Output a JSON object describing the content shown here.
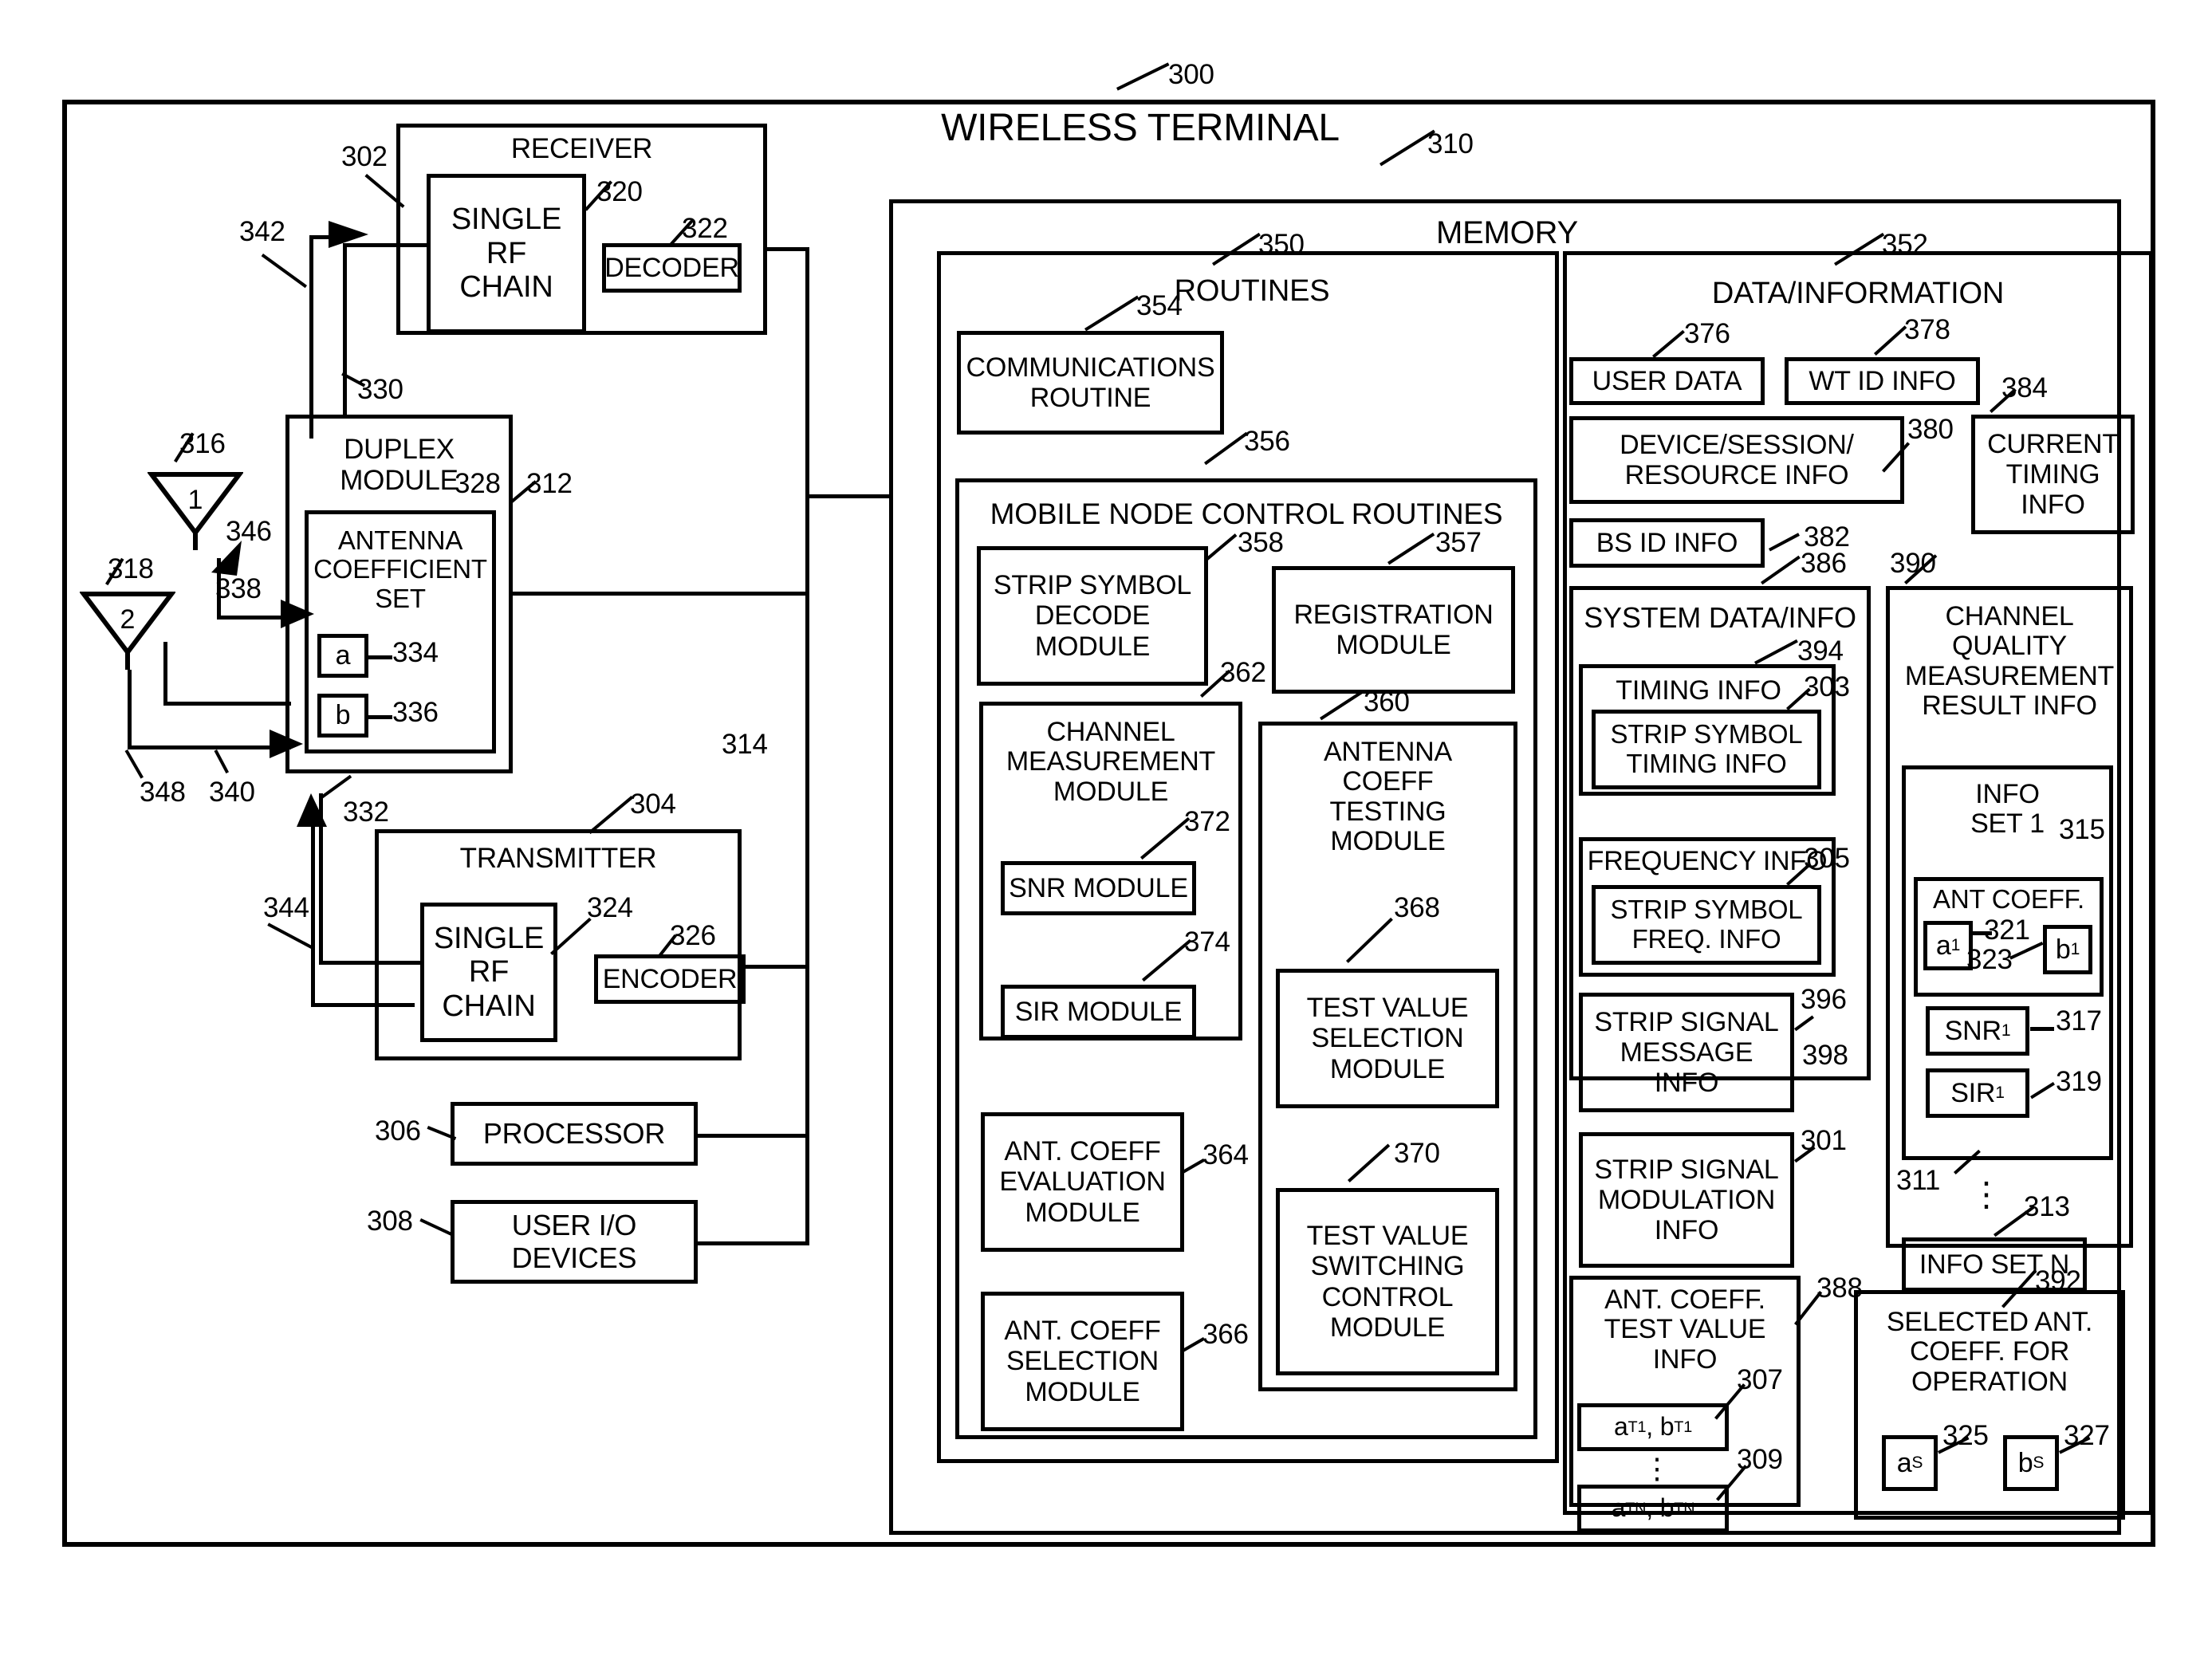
{
  "figure": {
    "title": "WIRELESS TERMINAL",
    "title_ref": "300"
  },
  "receiver": {
    "title": "RECEIVER",
    "ref": "302",
    "rf_chain": "SINGLE\nRF\nCHAIN",
    "rf_chain_ref": "320",
    "decoder": "DECODER",
    "decoder_ref": "322",
    "line_342": "342",
    "line_330": "330"
  },
  "duplex": {
    "title": "DUPLEX\nMODULE",
    "ref": "312",
    "coeff_title": "ANTENNA\nCOEFFICIENT\nSET",
    "coeff_ref": "328",
    "a_label": "a",
    "a_ref": "334",
    "b_label": "b",
    "b_ref": "336"
  },
  "antennas": {
    "first_label": "1",
    "first_ref": "316",
    "second_label": "2",
    "second_ref": "318",
    "line_346": "346",
    "line_338": "338",
    "line_348": "348",
    "line_340": "340",
    "line_332": "332",
    "line_344": "344",
    "bus_ref": "314"
  },
  "transmitter": {
    "title": "TRANSMITTER",
    "ref": "304",
    "rf_chain": "SINGLE\nRF\nCHAIN",
    "rf_chain_ref": "324",
    "encoder": "ENCODER",
    "encoder_ref": "326"
  },
  "processor": {
    "label": "PROCESSOR",
    "ref": "306"
  },
  "user_io": {
    "label": "USER I/O\nDEVICES",
    "ref": "308"
  },
  "memory": {
    "title": "MEMORY",
    "ref": "310"
  },
  "routines": {
    "title": "ROUTINES",
    "ref": "350",
    "communications": "COMMUNICATIONS\nROUTINE",
    "communications_ref": "354",
    "mobile_node_title": "MOBILE NODE CONTROL ROUTINES",
    "mobile_node_ref": "356",
    "strip_symbol_decode": "STRIP SYMBOL\nDECODE\nMODULE",
    "strip_symbol_decode_ref": "358",
    "registration": "REGISTRATION\nMODULE",
    "registration_ref": "357",
    "channel_measurement": "CHANNEL\nMEASUREMENT\nMODULE",
    "channel_measurement_ref": "362",
    "snr_module": "SNR MODULE",
    "snr_module_ref": "372",
    "sir_module": "SIR MODULE",
    "sir_module_ref": "374",
    "antenna_coeff_testing": "ANTENNA\nCOEFF\nTESTING\nMODULE",
    "antenna_coeff_testing_ref": "360",
    "test_value_selection": "TEST VALUE\nSELECTION\nMODULE",
    "test_value_selection_ref": "368",
    "test_value_switching": "TEST VALUE\nSWITCHING\nCONTROL\nMODULE",
    "test_value_switching_ref": "370",
    "ant_coeff_evaluation": "ANT. COEFF\nEVALUATION\nMODULE",
    "ant_coeff_evaluation_ref": "364",
    "ant_coeff_selection": "ANT. COEFF\nSELECTION\nMODULE",
    "ant_coeff_selection_ref": "366"
  },
  "data_info": {
    "title": "DATA/INFORMATION",
    "ref": "352",
    "user_data": "USER DATA",
    "user_data_ref": "376",
    "wt_id_info": "WT ID INFO",
    "wt_id_info_ref": "378",
    "device_session": "DEVICE/SESSION/\nRESOURCE INFO",
    "device_session_ref": "380",
    "bs_id_info": "BS ID INFO",
    "bs_id_info_ref": "382",
    "current_timing": "CURRENT\nTIMING\nINFO",
    "current_timing_ref": "384",
    "system_data_title": "SYSTEM DATA/INFO",
    "system_data_ref": "386",
    "timing_info": "TIMING INFO",
    "timing_info_ref": "394",
    "strip_symbol_timing": "STRIP SYMBOL\nTIMING INFO",
    "strip_symbol_timing_ref": "303",
    "frequency_info": "FREQUENCY INFO",
    "strip_symbol_freq": "STRIP SYMBOL\nFREQ. INFO",
    "strip_symbol_freq_ref": "305",
    "strip_signal_message": "STRIP SIGNAL\nMESSAGE\nINFO",
    "strip_signal_message_ref": "396",
    "strip_signal_modulation": "STRIP SIGNAL\nMODULATION\nINFO",
    "strip_signal_modulation_ref": "398",
    "strip_signal_modulation_ref2": "301",
    "channel_quality_title": "CHANNEL\nQUALITY\nMEASUREMENT\nRESULT INFO",
    "channel_quality_ref": "390",
    "info_set_1": "INFO\nSET 1",
    "info_set_1_ref": "315",
    "ant_coeff": "ANT COEFF.",
    "a1": "a",
    "a1_sub": "1",
    "a1_ref": "321",
    "b1": "b",
    "b1_sub": "1",
    "b1_ref": "323",
    "snr1": "SNR",
    "snr1_sub": "1",
    "snr1_ref": "317",
    "sir1": "SIR",
    "sir1_sub": "1",
    "sir1_ref": "319",
    "info_set_block_ref": "311",
    "info_set_n": "INFO SET N",
    "info_set_n_ref": "313",
    "ant_coeff_test_value_title": "ANT. COEFF.\nTEST VALUE\nINFO",
    "ant_coeff_test_value_ref": "388",
    "test_a_t1": "a",
    "test_a_t1_sub": "T1",
    "test_b_t1": "b",
    "test_b_t1_sub": "T1",
    "test_t1_ref": "307",
    "test_a_tn": "a",
    "test_a_tn_sub": "TN",
    "test_b_tn": "b",
    "test_b_tn_sub": "TN",
    "test_tn_ref": "309",
    "selected_title": "SELECTED ANT.\nCOEFF. FOR\nOPERATION",
    "selected_ref": "392",
    "as": "a",
    "as_sub": "S",
    "as_ref": "325",
    "bs": "b",
    "bs_sub": "S",
    "bs_ref": "327"
  }
}
